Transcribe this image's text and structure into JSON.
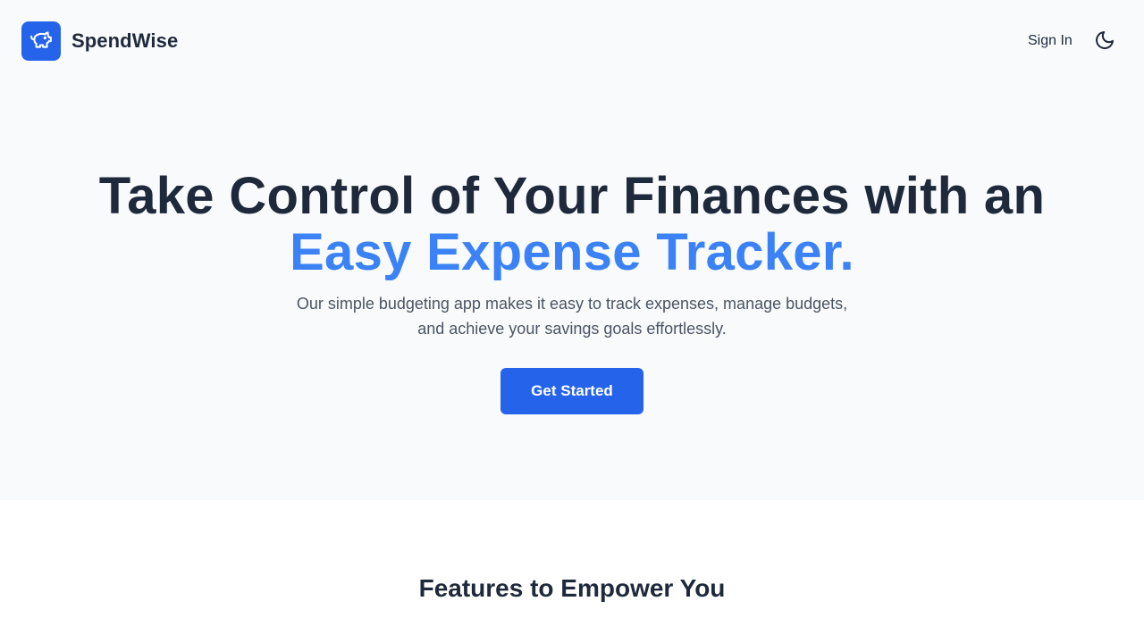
{
  "header": {
    "brand": "SpendWise",
    "logo_icon": "piggy-bank-icon",
    "signin_label": "Sign In",
    "theme_icon": "moon-icon"
  },
  "hero": {
    "title_line1": "Take Control of Your Finances with an",
    "title_line2": "Easy Expense Tracker.",
    "subtitle": "Our simple budgeting app makes it easy to track expenses, manage budgets, and achieve your savings goals effortlessly.",
    "cta_label": "Get Started"
  },
  "features": {
    "title": "Features to Empower You"
  },
  "colors": {
    "primary": "#2563eb",
    "accent_text": "#3b82f6",
    "heading": "#1e293b",
    "body_text": "#4b5563",
    "hero_bg": "#f8fafc"
  }
}
